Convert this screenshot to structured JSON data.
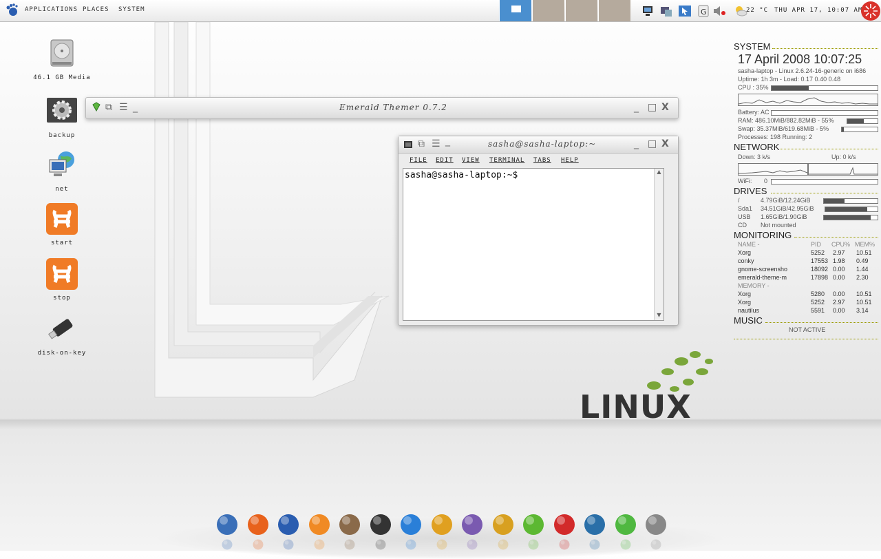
{
  "panel": {
    "menus": [
      "Applications",
      "Places",
      "System"
    ],
    "weather": "22 °C",
    "datetime": "THU APR 17, 10:07 AM"
  },
  "desktop_icons": [
    "46.1 GB Media",
    "backup",
    "net",
    "start",
    "stop",
    "disk-on-key"
  ],
  "windows": {
    "emerald": {
      "title": "Emerald Themer 0.7.2"
    },
    "terminal": {
      "title": "sasha@sasha-laptop:~",
      "menus": [
        "File",
        "Edit",
        "View",
        "Terminal",
        "Tabs",
        "Help"
      ],
      "prompt": "sasha@sasha-laptop:~$"
    }
  },
  "watermark": "LINUX",
  "conky": {
    "system": {
      "header": "SYSTEM",
      "date": "17 April 2008 10:07:25",
      "host": "sasha-laptop - Linux 2.6.24-16-generic on i686",
      "uptime": "Uptime: 1h 3m - Load: 0.17 0.40 0.48",
      "cpu": "CPU : 35%",
      "cpu_pct": 35,
      "battery": "Battery: AC",
      "ram": "RAM: 486.10MiB/882.82MiB - 55%",
      "ram_pct": 55,
      "swap": "Swap: 35.37MiB/619.68MiB - 5%",
      "swap_pct": 5,
      "processes": "Processes: 198  Running: 2"
    },
    "network": {
      "header": "NETWORK",
      "down": "Down: 3 k/s",
      "up": "Up: 0 k/s",
      "wifi": "WiFi:",
      "wifi_val": "0"
    },
    "drives": {
      "header": "DRIVES",
      "rows": [
        {
          "name": "/",
          "value": "4.79GiB/12.24GiB",
          "pct": 39
        },
        {
          "name": "Sda1",
          "value": "34.51GiB/42.95GiB",
          "pct": 80
        },
        {
          "name": "USB",
          "value": "1.65GiB/1.90GiB",
          "pct": 87
        },
        {
          "name": "CD",
          "value": "Not mounted"
        }
      ]
    },
    "monitoring": {
      "header": "MONITORING",
      "cols": [
        "NAME -",
        "PID",
        "CPU%",
        "MEM%"
      ],
      "cpu_rows": [
        [
          "Xorg",
          "5252",
          "2.97",
          "10.51"
        ],
        [
          "conky",
          "17553",
          "1.98",
          "0.49"
        ],
        [
          "gnome-screensho",
          "18092",
          "0.00",
          "1.44"
        ],
        [
          "emerald-theme-m",
          "17898",
          "0.00",
          "2.30"
        ]
      ],
      "mem_label": "MEMORY -",
      "mem_rows": [
        [
          "Xorg",
          "5280",
          "0.00",
          "10.51"
        ],
        [
          "Xorg",
          "5252",
          "2.97",
          "10.51"
        ],
        [
          "nautilus",
          "5591",
          "0.00",
          "3.14"
        ]
      ]
    },
    "music": {
      "header": "MUSIC",
      "status": "NOT ACTIVE"
    }
  },
  "dock_icons": [
    "desktop-icon",
    "firefox-icon",
    "thunderbird-icon",
    "blender-icon",
    "gimp-icon",
    "terminal-icon",
    "writer-icon",
    "chart-icon",
    "pidgin-icon",
    "chat-icon",
    "skype-icon",
    "tux-icon",
    "web-icon",
    "emerald-icon",
    "trash-icon"
  ]
}
